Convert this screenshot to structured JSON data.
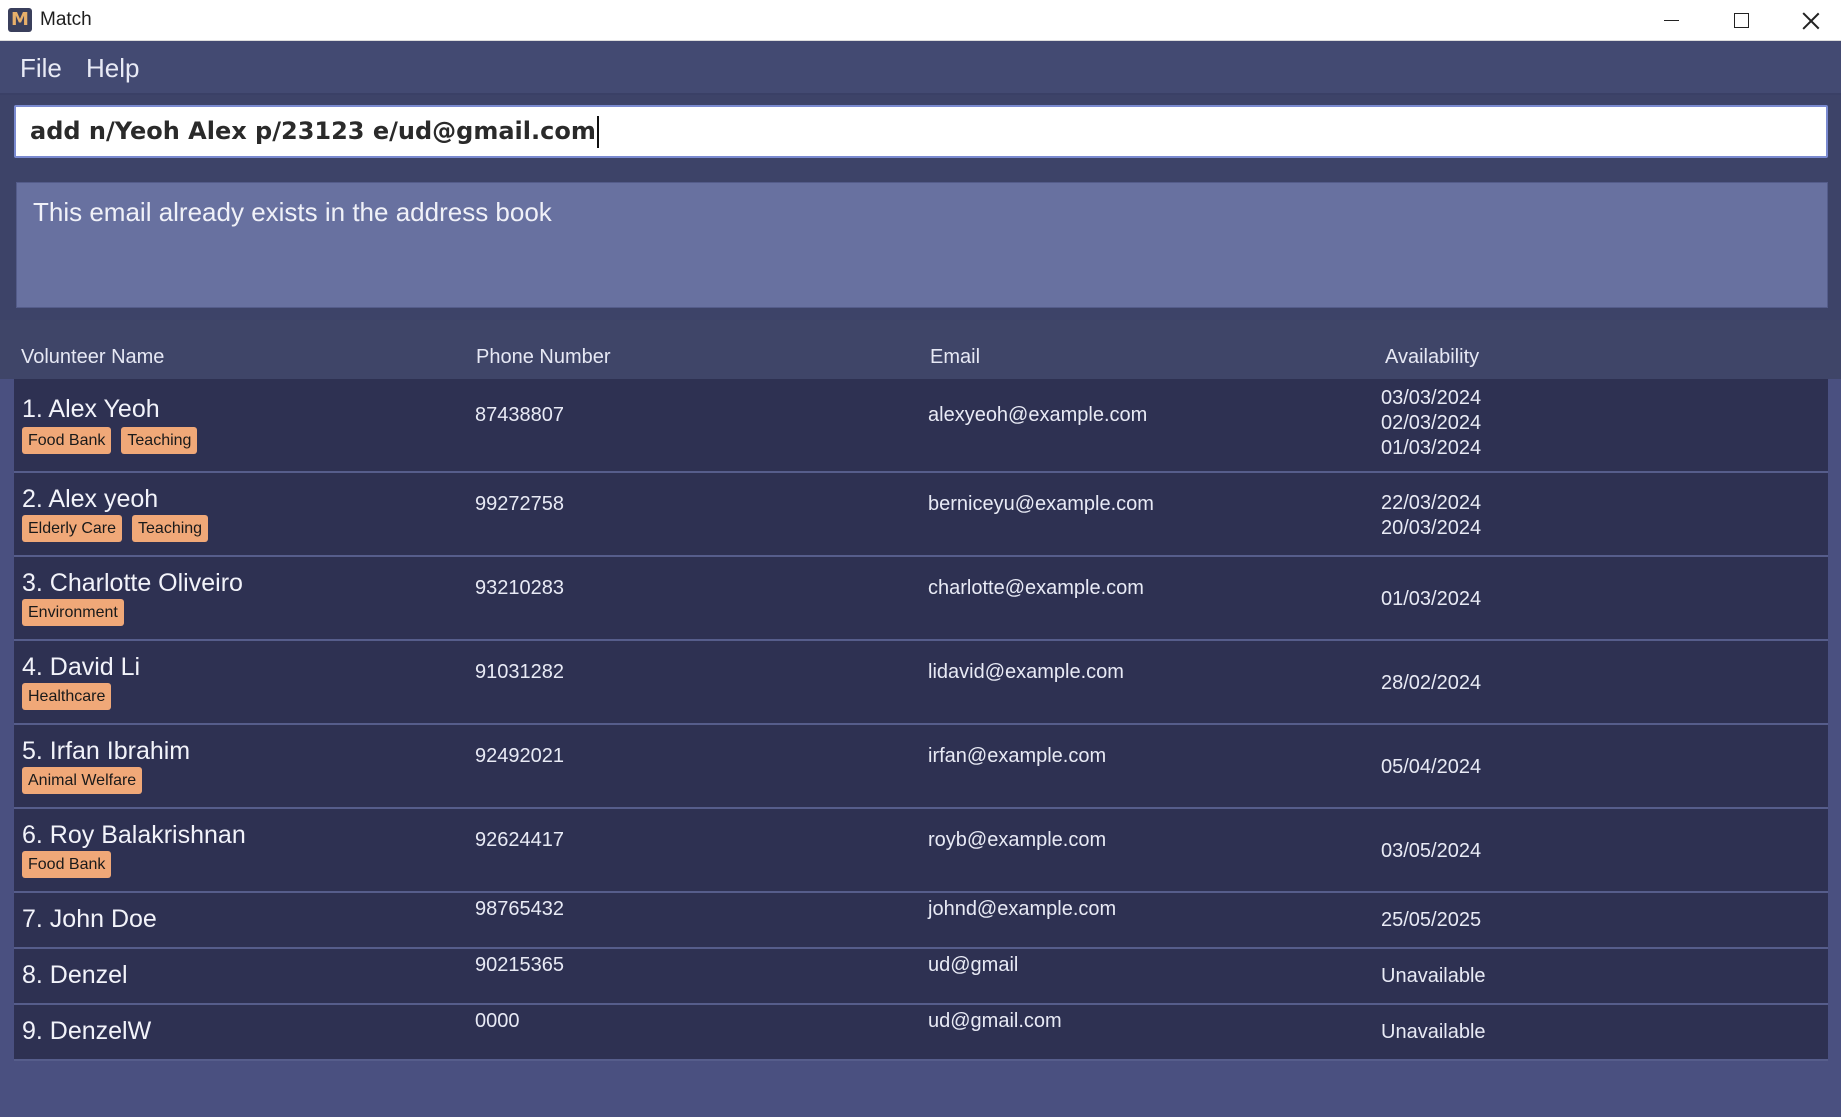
{
  "window": {
    "title": "Match",
    "icon_letter": "M"
  },
  "menu": {
    "file": "File",
    "help": "Help"
  },
  "command": {
    "value": "add n/Yeoh Alex p/23123 e/ud@gmail.com"
  },
  "result": {
    "message": "This email already exists in the address book"
  },
  "table": {
    "headers": {
      "name": "Volunteer Name",
      "phone": "Phone Number",
      "email": "Email",
      "availability": "Availability"
    },
    "rows": [
      {
        "name": "1. Alex Yeoh",
        "phone": "87438807",
        "email": "alexyeoh@example.com",
        "tags": [
          "Food Bank",
          "Teaching"
        ],
        "availability": [
          "03/03/2024",
          "02/03/2024",
          "01/03/2024"
        ]
      },
      {
        "name": "2. Alex yeoh",
        "phone": "99272758",
        "email": "berniceyu@example.com",
        "tags": [
          "Elderly Care",
          "Teaching"
        ],
        "availability": [
          "22/03/2024",
          "20/03/2024"
        ]
      },
      {
        "name": "3. Charlotte Oliveiro",
        "phone": "93210283",
        "email": "charlotte@example.com",
        "tags": [
          "Environment"
        ],
        "availability": [
          "01/03/2024"
        ]
      },
      {
        "name": "4. David Li",
        "phone": "91031282",
        "email": "lidavid@example.com",
        "tags": [
          "Healthcare"
        ],
        "availability": [
          "28/02/2024"
        ]
      },
      {
        "name": "5. Irfan Ibrahim",
        "phone": "92492021",
        "email": "irfan@example.com",
        "tags": [
          "Animal Welfare"
        ],
        "availability": [
          "05/04/2024"
        ]
      },
      {
        "name": "6. Roy Balakrishnan",
        "phone": "92624417",
        "email": "royb@example.com",
        "tags": [
          "Food Bank"
        ],
        "availability": [
          "03/05/2024"
        ]
      },
      {
        "name": "7. John Doe",
        "phone": "98765432",
        "email": "johnd@example.com",
        "tags": [],
        "availability": [
          "25/05/2025"
        ]
      },
      {
        "name": "8. Denzel",
        "phone": "90215365",
        "email": "ud@gmail",
        "tags": [],
        "availability": [
          "Unavailable"
        ]
      },
      {
        "name": "9. DenzelW",
        "phone": "0000",
        "email": "ud@gmail.com",
        "tags": [],
        "availability": [
          "Unavailable"
        ]
      }
    ]
  }
}
